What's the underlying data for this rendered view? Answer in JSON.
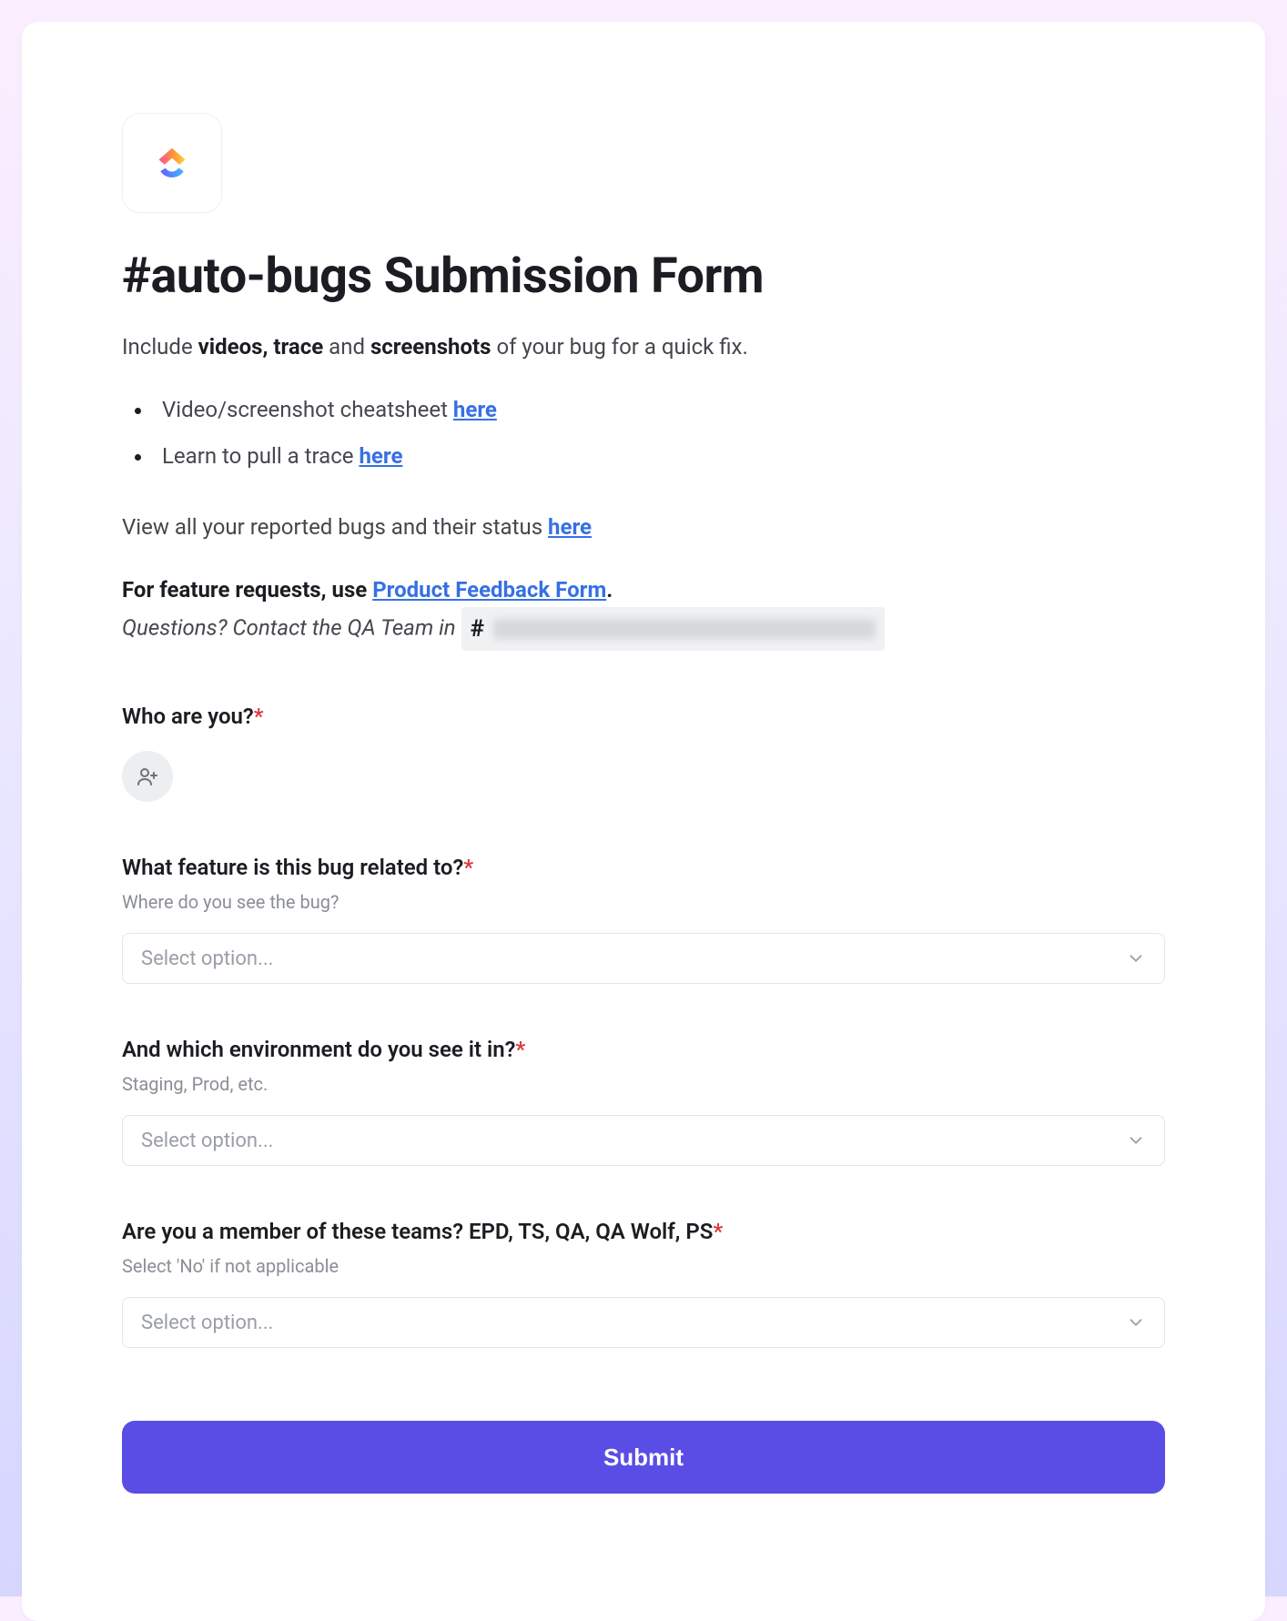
{
  "header": {
    "title": "#auto-bugs Submission Form"
  },
  "intro": {
    "lead_pre": "Include ",
    "lead_b1": "videos, trace",
    "lead_mid": " and ",
    "lead_b2": "screenshots",
    "lead_post": " of your bug for a quick fix.",
    "bullet1_pre": "Video/screenshot cheatsheet ",
    "bullet1_link": "here",
    "bullet2_pre": "Learn to pull a trace ",
    "bullet2_link": "here",
    "view_pre": "View all your reported bugs and their status ",
    "view_link": "here",
    "feature_pre": "For feature requests, use ",
    "feature_link": "Product Feedback Form",
    "feature_post": ".",
    "contact_pre": "Questions? Contact the QA Team in  ",
    "hash": "#"
  },
  "fields": {
    "who": {
      "label": "Who are you?"
    },
    "feature": {
      "label": "What feature is this bug related to?",
      "help": "Where do you see the bug?",
      "placeholder": "Select option..."
    },
    "env": {
      "label": "And which environment do you see it in?",
      "help": "Staging, Prod, etc.",
      "placeholder": "Select option..."
    },
    "team": {
      "label": "Are you a member of these teams? EPD, TS, QA, QA Wolf, PS",
      "help": "Select 'No' if not applicable",
      "placeholder": "Select option..."
    }
  },
  "required_mark": "*",
  "submit_label": "Submit"
}
